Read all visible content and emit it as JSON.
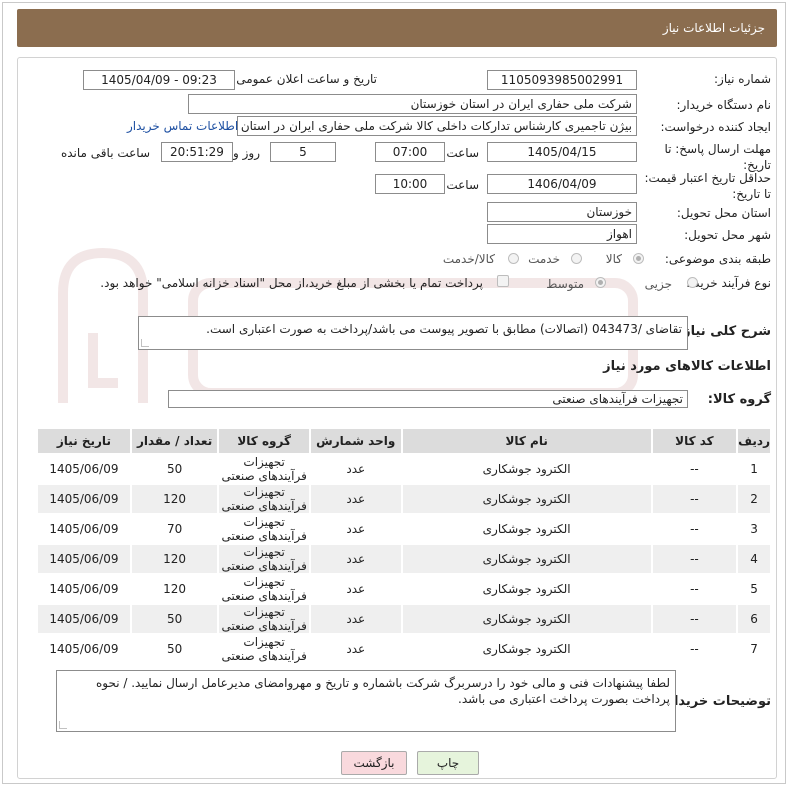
{
  "header": {
    "title": "جزئیات اطلاعات نیاز"
  },
  "form": {
    "need_number_label": "شماره نیاز:",
    "need_number": "1105093985002991",
    "announce_label": "تاریخ و ساعت اعلان عمومی:",
    "announce_value": "1405/04/09 - 09:23",
    "buyer_org_label": "نام دستگاه خریدار:",
    "buyer_org": "شرکت ملی حفاری ایران در استان خوزستان",
    "creator_label": "ایجاد کننده درخواست:",
    "creator": "بیژن تاجمیری کارشناس تدارکات داخلی کالا شرکت ملی حفاری ایران در استان خوزستان",
    "contact_link": "اطلاعات تماس خریدار",
    "deadline_label": "مهلت ارسال پاسخ: تا تاریخ:",
    "deadline_date": "1405/04/15",
    "time_label": "ساعت",
    "deadline_time": "07:00",
    "days": "5",
    "days_and": "روز و",
    "remaining": "20:51:29",
    "remaining_label": "ساعت باقی مانده",
    "validity_label": "حداقل تاریخ اعتبار قیمت: تا تاریخ:",
    "validity_date": "1406/04/09",
    "validity_time_label": "ساعت",
    "validity_time": "10:00",
    "province_label": "استان محل تحویل:",
    "province": "خوزستان",
    "city_label": "شهر محل تحویل:",
    "city": "اهواز",
    "category_label": "طبقه بندی موضوعی:",
    "category_options": [
      "کالا",
      "خدمت",
      "کالا/خدمت"
    ],
    "process_label": "نوع فرآیند خرید :",
    "process_options": [
      "جزیی",
      "متوسط"
    ],
    "payment_note": "پرداخت تمام یا بخشی از مبلغ خرید،از محل \"اسناد خزانه اسلامی\" خواهد بود."
  },
  "description": {
    "label": "شرح کلی نیاز:",
    "text": "تقاضای /043473 (اتصالات) مطابق با تصویر پیوست می باشد/پرداخت به صورت اعتباری است."
  },
  "goods": {
    "section_title": "اطلاعات کالاهای مورد نیاز",
    "group_label": "گروه کالا:",
    "group_value": "تجهیزات فرآیندهای صنعتی",
    "columns": [
      "ردیف",
      "کد کالا",
      "نام کالا",
      "واحد شمارش",
      "گروه کالا",
      "تعداد / مقدار",
      "تاریخ نیاز"
    ],
    "rows": [
      [
        "1",
        "--",
        "الکترود جوشکاری",
        "عدد",
        "تجهیزات فرآیندهای صنعتی",
        "50",
        "1405/06/09"
      ],
      [
        "2",
        "--",
        "الکترود جوشکاری",
        "عدد",
        "تجهیزات فرآیندهای صنعتی",
        "120",
        "1405/06/09"
      ],
      [
        "3",
        "--",
        "الکترود جوشکاری",
        "عدد",
        "تجهیزات فرآیندهای صنعتی",
        "70",
        "1405/06/09"
      ],
      [
        "4",
        "--",
        "الکترود جوشکاری",
        "عدد",
        "تجهیزات فرآیندهای صنعتی",
        "120",
        "1405/06/09"
      ],
      [
        "5",
        "--",
        "الکترود جوشکاری",
        "عدد",
        "تجهیزات فرآیندهای صنعتی",
        "120",
        "1405/06/09"
      ],
      [
        "6",
        "--",
        "الکترود جوشکاری",
        "عدد",
        "تجهیزات فرآیندهای صنعتی",
        "50",
        "1405/06/09"
      ],
      [
        "7",
        "--",
        "الکترود جوشکاری",
        "عدد",
        "تجهیزات فرآیندهای صنعتی",
        "50",
        "1405/06/09"
      ]
    ]
  },
  "buyer_notes": {
    "label": "توضیحات خریدار:",
    "text": "لطفا پیشنهادات فنی و مالی خود را درسربرگ شرکت باشماره و تاریخ و مهروامضای مدیرعامل ارسال نمایید. / نحوه پرداخت بصورت پرداخت اعتباری می باشد."
  },
  "buttons": {
    "print": "چاپ",
    "back": "بازگشت"
  },
  "colors": {
    "title_bg": "#8b6d4f",
    "link": "#1e50a2",
    "back_btn_bg": "#f9d9dd",
    "print_btn_bg": "#e6f4dc"
  }
}
